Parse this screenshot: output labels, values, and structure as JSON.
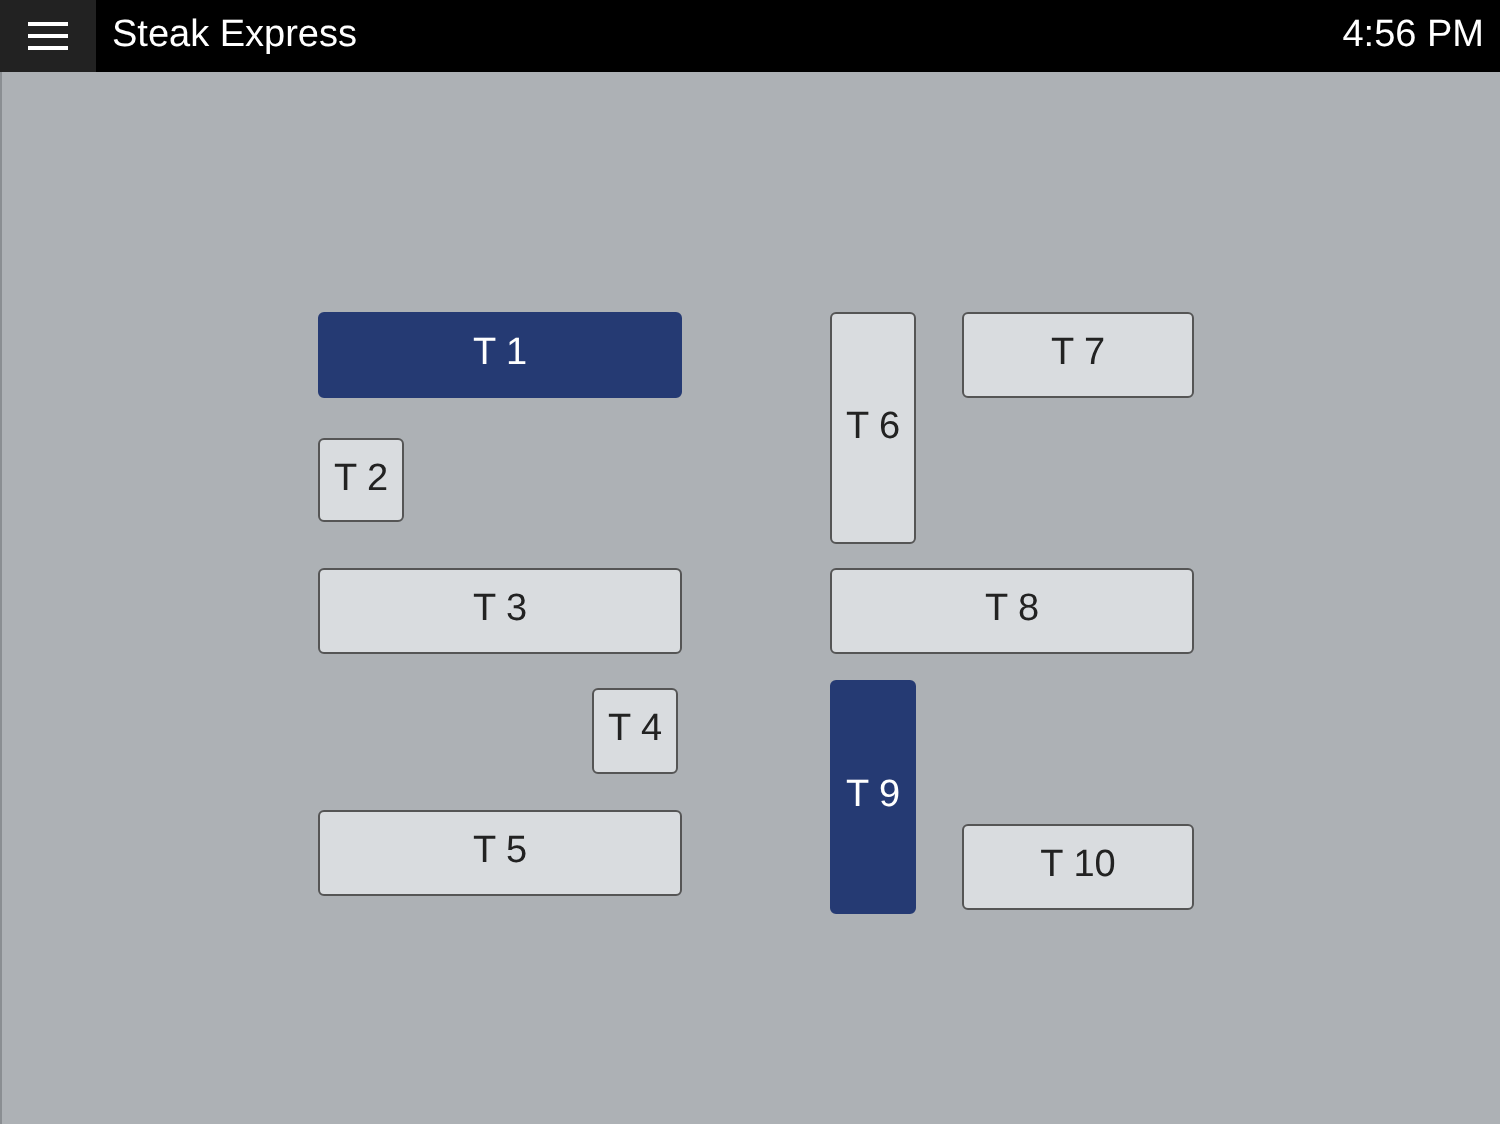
{
  "header": {
    "title": "Steak Express",
    "time": "4:56 PM"
  },
  "tables": [
    {
      "label": "T 1",
      "occupied": true
    },
    {
      "label": "T 2",
      "occupied": false
    },
    {
      "label": "T 3",
      "occupied": false
    },
    {
      "label": "T 4",
      "occupied": false
    },
    {
      "label": "T 5",
      "occupied": false
    },
    {
      "label": "T 6",
      "occupied": false
    },
    {
      "label": "T 7",
      "occupied": false
    },
    {
      "label": "T 8",
      "occupied": false
    },
    {
      "label": "T 9",
      "occupied": true
    },
    {
      "label": "T 10",
      "occupied": false
    }
  ]
}
